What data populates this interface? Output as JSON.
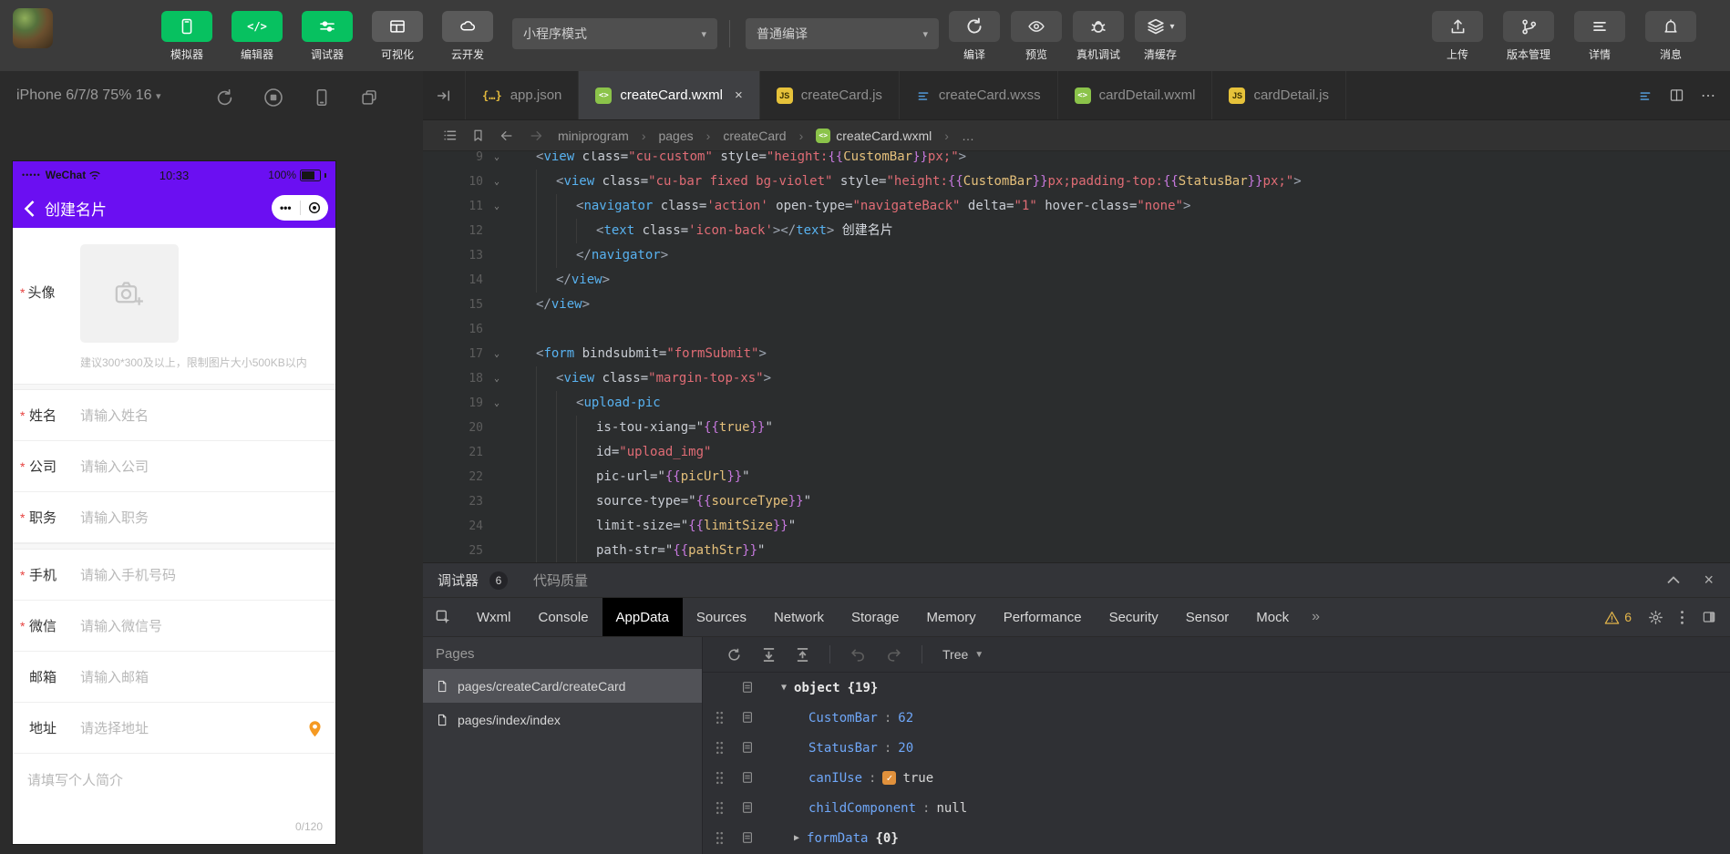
{
  "colors": {
    "wechat_green": "#07c160",
    "phone_purple": "#6b0ff2",
    "warning_yellow": "#e3b54a",
    "tree_key_blue": "#6fa7f8",
    "checkbox_orange": "#e1913c",
    "tag_blue": "#58b2f0",
    "string_red": "#e06c75",
    "mustache_magenta": "#c678dd",
    "ident_yellow": "#e5c07b"
  },
  "toolbar": {
    "nav_buttons": [
      {
        "label": "模拟器",
        "icon": "simulator-icon",
        "style": "green"
      },
      {
        "label": "编辑器",
        "icon": "editor-icon",
        "style": "green"
      },
      {
        "label": "调试器",
        "icon": "debugger-icon",
        "style": "green"
      },
      {
        "label": "可视化",
        "icon": "visualization-icon",
        "style": "gray"
      },
      {
        "label": "云开发",
        "icon": "cloud-dev-icon",
        "style": "gray"
      }
    ],
    "mode_dropdown": {
      "value": "小程序模式"
    },
    "compile_dropdown": {
      "value": "普通编译"
    },
    "compile_actions": [
      {
        "label": "编译",
        "icon": "compile-icon",
        "caret": false
      },
      {
        "label": "预览",
        "icon": "preview-icon",
        "caret": false
      },
      {
        "label": "真机调试",
        "icon": "remote-debug-icon",
        "caret": false
      },
      {
        "label": "清缓存",
        "icon": "clear-cache-icon",
        "caret": true
      }
    ],
    "right_buttons": [
      {
        "label": "上传",
        "icon": "upload-icon"
      },
      {
        "label": "版本管理",
        "icon": "version-icon"
      },
      {
        "label": "详情",
        "icon": "details-icon"
      },
      {
        "label": "消息",
        "icon": "message-icon"
      }
    ]
  },
  "simulator": {
    "device_selector": "iPhone 6/7/8 75% 16",
    "phone": {
      "status_bar": {
        "signal_dots": "•••••",
        "carrier": "WeChat",
        "time": "10:33",
        "battery": "100%"
      },
      "nav": {
        "title": "创建名片",
        "menu_dots": "•••"
      },
      "form": {
        "avatar": {
          "label": "头像",
          "required": true,
          "hint": "建议300*300及以上，限制图片大小500KB以内"
        },
        "fields": [
          {
            "label": "姓名",
            "placeholder": "请输入姓名",
            "required": true,
            "gap_after": false
          },
          {
            "label": "公司",
            "placeholder": "请输入公司",
            "required": true,
            "gap_after": false
          },
          {
            "label": "职务",
            "placeholder": "请输入职务",
            "required": true,
            "gap_after": true
          },
          {
            "label": "手机",
            "placeholder": "请输入手机号码",
            "required": true,
            "gap_after": false
          },
          {
            "label": "微信",
            "placeholder": "请输入微信号",
            "required": true,
            "gap_after": false
          },
          {
            "label": "邮箱",
            "placeholder": "请输入邮箱",
            "required": false,
            "gap_after": false
          },
          {
            "label": "地址",
            "placeholder": "请选择地址",
            "required": false,
            "gap_after": false,
            "trailing_icon": "location-pin-icon"
          }
        ],
        "intro": {
          "placeholder": "请填写个人简介",
          "counter": "0/120"
        }
      }
    }
  },
  "editor": {
    "tabs": [
      {
        "name": "app.json",
        "icon": "json",
        "active": false,
        "closable": false
      },
      {
        "name": "createCard.wxml",
        "icon": "wxml",
        "active": true,
        "closable": true
      },
      {
        "name": "createCard.js",
        "icon": "js",
        "active": false,
        "closable": false
      },
      {
        "name": "createCard.wxss",
        "icon": "wxss",
        "active": false,
        "closable": false
      },
      {
        "name": "cardDetail.wxml",
        "icon": "wxml",
        "active": false,
        "closable": false
      },
      {
        "name": "cardDetail.js",
        "icon": "js",
        "active": false,
        "closable": false
      }
    ],
    "breadcrumb": {
      "items": [
        "miniprogram",
        "pages",
        "createCard",
        "createCard.wxml",
        "…"
      ],
      "file_icon_index": 3
    },
    "code": {
      "lines": [
        {
          "n": 9,
          "fold": true,
          "ind": 0,
          "t": [
            [
              "p",
              "<"
            ],
            [
              "t",
              "view"
            ],
            [
              "a",
              " class="
            ],
            [
              "s",
              "\"cu-custom\""
            ],
            [
              "a",
              " style="
            ],
            [
              "s",
              "\"height:"
            ],
            [
              "b",
              "{{"
            ],
            [
              "i",
              "CustomBar"
            ],
            [
              "b",
              "}}"
            ],
            [
              "s",
              "px;\""
            ],
            [
              "p",
              ">"
            ]
          ]
        },
        {
          "n": 10,
          "fold": true,
          "ind": 1,
          "t": [
            [
              "p",
              "<"
            ],
            [
              "t",
              "view"
            ],
            [
              "a",
              " class="
            ],
            [
              "s",
              "\"cu-bar fixed bg-violet\""
            ],
            [
              "a",
              " style="
            ],
            [
              "s",
              "\"height:"
            ],
            [
              "b",
              "{{"
            ],
            [
              "i",
              "CustomBar"
            ],
            [
              "b",
              "}}"
            ],
            [
              "s",
              "px;padding-top:"
            ],
            [
              "b",
              "{{"
            ],
            [
              "i",
              "StatusBar"
            ],
            [
              "b",
              "}}"
            ],
            [
              "s",
              "px;\""
            ],
            [
              "p",
              ">"
            ]
          ]
        },
        {
          "n": 11,
          "fold": true,
          "ind": 2,
          "t": [
            [
              "p",
              "<"
            ],
            [
              "t",
              "navigator"
            ],
            [
              "a",
              " class="
            ],
            [
              "s",
              "'action'"
            ],
            [
              "a",
              " open-type="
            ],
            [
              "s",
              "\"navigateBack\""
            ],
            [
              "a",
              " delta="
            ],
            [
              "s",
              "\"1\""
            ],
            [
              "a",
              " hover-class="
            ],
            [
              "s",
              "\"none\""
            ],
            [
              "p",
              ">"
            ]
          ]
        },
        {
          "n": 12,
          "fold": false,
          "ind": 3,
          "t": [
            [
              "p",
              "<"
            ],
            [
              "t",
              "text"
            ],
            [
              "a",
              " class="
            ],
            [
              "s",
              "'icon-back'"
            ],
            [
              "p",
              "></"
            ],
            [
              "t",
              "text"
            ],
            [
              "p",
              ">"
            ],
            [
              "x",
              " 创建名片"
            ]
          ]
        },
        {
          "n": 13,
          "fold": false,
          "ind": 2,
          "t": [
            [
              "p",
              "</"
            ],
            [
              "t",
              "navigator"
            ],
            [
              "p",
              ">"
            ]
          ]
        },
        {
          "n": 14,
          "fold": false,
          "ind": 1,
          "t": [
            [
              "p",
              "</"
            ],
            [
              "t",
              "view"
            ],
            [
              "p",
              ">"
            ]
          ]
        },
        {
          "n": 15,
          "fold": false,
          "ind": 0,
          "t": [
            [
              "p",
              "</"
            ],
            [
              "t",
              "view"
            ],
            [
              "p",
              ">"
            ]
          ]
        },
        {
          "n": 16,
          "fold": false,
          "ind": 0,
          "t": []
        },
        {
          "n": 17,
          "fold": true,
          "ind": 0,
          "t": [
            [
              "p",
              "<"
            ],
            [
              "t",
              "form"
            ],
            [
              "a",
              " bindsubmit="
            ],
            [
              "s",
              "\"formSubmit\""
            ],
            [
              "p",
              ">"
            ]
          ]
        },
        {
          "n": 18,
          "fold": true,
          "ind": 1,
          "t": [
            [
              "p",
              "<"
            ],
            [
              "t",
              "view"
            ],
            [
              "a",
              " class="
            ],
            [
              "s",
              "\"margin-top-xs\""
            ],
            [
              "p",
              ">"
            ]
          ]
        },
        {
          "n": 19,
          "fold": true,
          "ind": 2,
          "t": [
            [
              "p",
              "<"
            ],
            [
              "t",
              "upload-pic"
            ]
          ]
        },
        {
          "n": 20,
          "fold": false,
          "ind": 3,
          "t": [
            [
              "a",
              "is-tou-xiang="
            ],
            [
              "q",
              "\""
            ],
            [
              "b",
              "{{"
            ],
            [
              "i",
              "true"
            ],
            [
              "b",
              "}}"
            ],
            [
              "q",
              "\""
            ]
          ]
        },
        {
          "n": 21,
          "fold": false,
          "ind": 3,
          "t": [
            [
              "a",
              "id="
            ],
            [
              "s",
              "\"upload_img\""
            ]
          ]
        },
        {
          "n": 22,
          "fold": false,
          "ind": 3,
          "t": [
            [
              "a",
              "pic-url="
            ],
            [
              "q",
              "\""
            ],
            [
              "b",
              "{{"
            ],
            [
              "i",
              "picUrl"
            ],
            [
              "b",
              "}}"
            ],
            [
              "q",
              "\""
            ]
          ]
        },
        {
          "n": 23,
          "fold": false,
          "ind": 3,
          "t": [
            [
              "a",
              "source-type="
            ],
            [
              "q",
              "\""
            ],
            [
              "b",
              "{{"
            ],
            [
              "i",
              "sourceType"
            ],
            [
              "b",
              "}}"
            ],
            [
              "q",
              "\""
            ]
          ]
        },
        {
          "n": 24,
          "fold": false,
          "ind": 3,
          "t": [
            [
              "a",
              "limit-size="
            ],
            [
              "q",
              "\""
            ],
            [
              "b",
              "{{"
            ],
            [
              "i",
              "limitSize"
            ],
            [
              "b",
              "}}"
            ],
            [
              "q",
              "\""
            ]
          ]
        },
        {
          "n": 25,
          "fold": false,
          "ind": 3,
          "t": [
            [
              "a",
              "path-str="
            ],
            [
              "q",
              "\""
            ],
            [
              "b",
              "{{"
            ],
            [
              "i",
              "pathStr"
            ],
            [
              "b",
              "}}"
            ],
            [
              "q",
              "\""
            ]
          ]
        }
      ]
    }
  },
  "debug": {
    "header": {
      "title": "调试器",
      "badge": "6",
      "secondary": "代码质量"
    },
    "tabs": [
      "Wxml",
      "Console",
      "AppData",
      "Sources",
      "Network",
      "Storage",
      "Memory",
      "Performance",
      "Security",
      "Sensor",
      "Mock"
    ],
    "active_tab": "AppData",
    "overflow_glyph": "»",
    "warning_count": "6",
    "pages": {
      "header": "Pages",
      "items": [
        "pages/createCard/createCard",
        "pages/index/index"
      ],
      "selected_index": 0
    },
    "appdata": {
      "view_mode": "Tree",
      "tree": [
        {
          "kind": "object",
          "label": "object",
          "count": "{19}",
          "state": "expanded",
          "handle": false
        },
        {
          "kind": "number",
          "key": "CustomBar",
          "value": "62",
          "handle": true
        },
        {
          "kind": "number",
          "key": "StatusBar",
          "value": "20",
          "handle": true
        },
        {
          "kind": "boolean",
          "key": "canIUse",
          "value": "true",
          "checked": true,
          "handle": true
        },
        {
          "kind": "null",
          "key": "childComponent",
          "value": "null",
          "handle": true
        },
        {
          "kind": "collapsed",
          "key": "formData",
          "count": "{0}",
          "state": "collapsed",
          "handle": true
        }
      ]
    }
  }
}
